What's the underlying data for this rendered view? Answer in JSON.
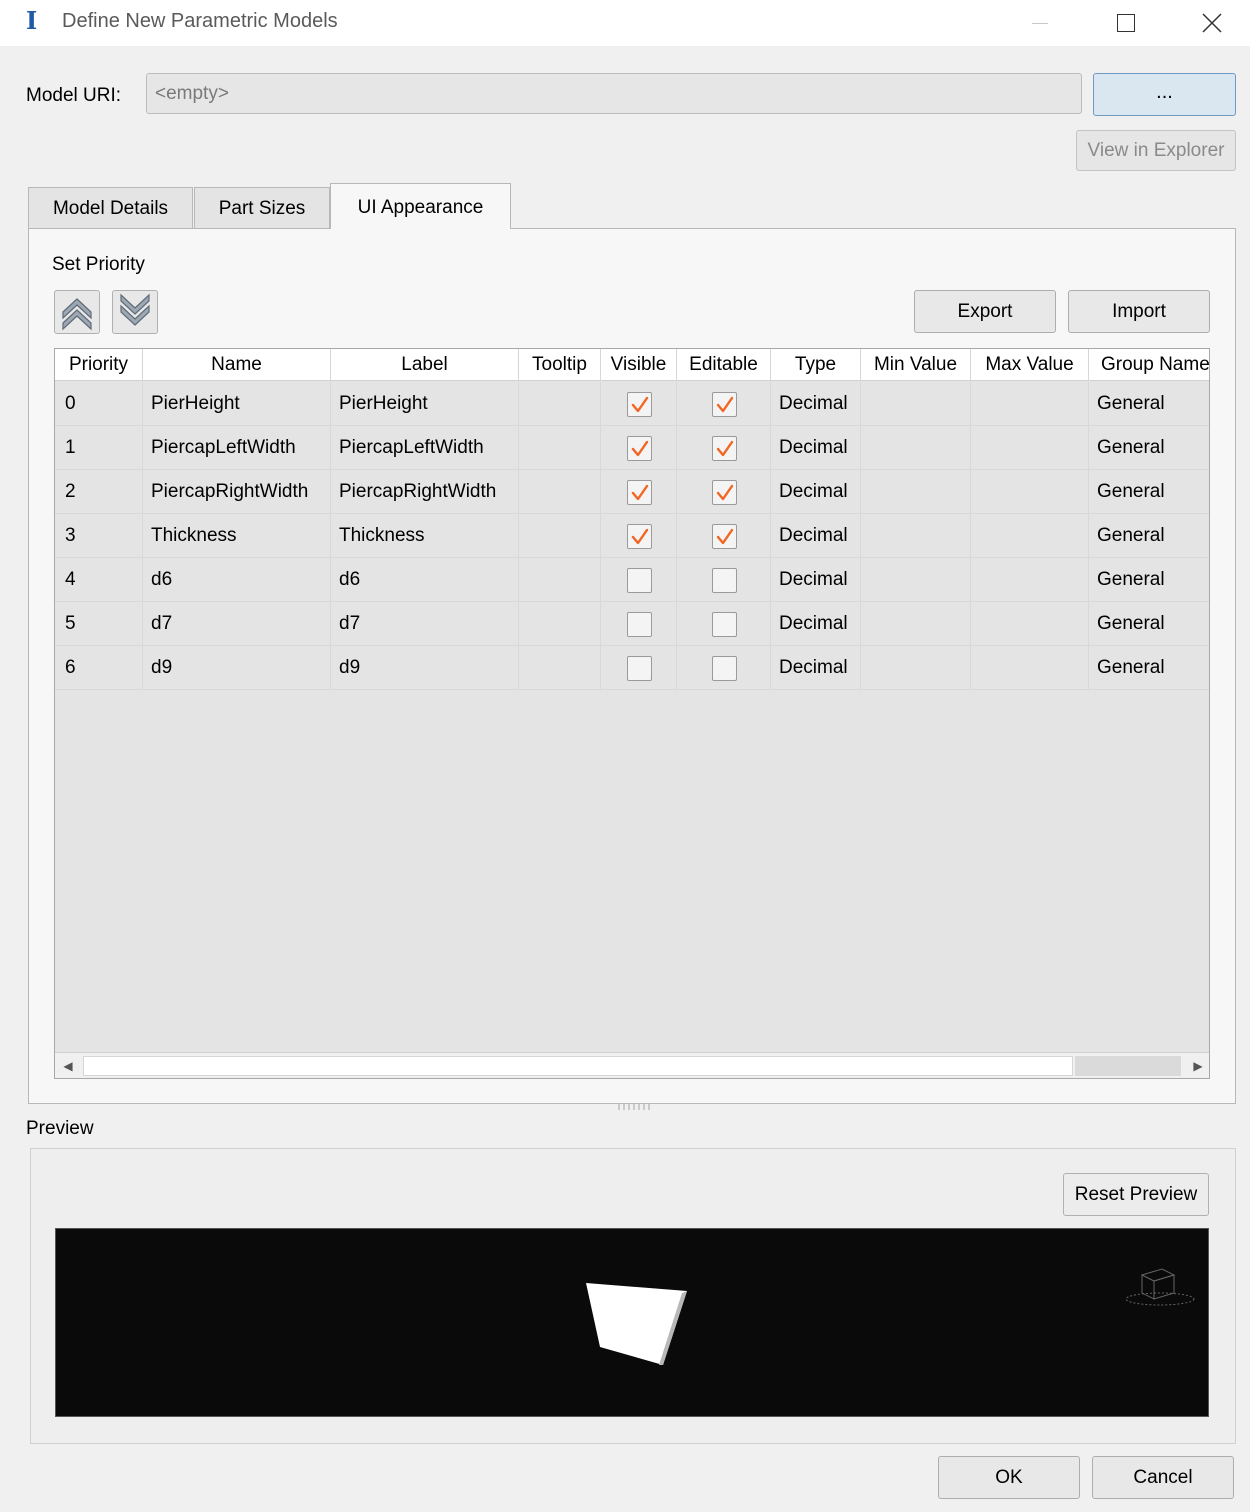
{
  "window": {
    "title": "Define New Parametric Models",
    "app_icon": "I"
  },
  "model_uri": {
    "label": "Model URI:",
    "value": "<empty>",
    "browse_label": "...",
    "explorer_label": "View in Explorer"
  },
  "tabs": [
    {
      "label": "Model Details",
      "active": false
    },
    {
      "label": "Part Sizes",
      "active": false
    },
    {
      "label": "UI Appearance",
      "active": true
    }
  ],
  "set_priority": {
    "label": "Set Priority",
    "up_icon": "double-chevron-up-icon",
    "down_icon": "double-chevron-down-icon"
  },
  "toolbar": {
    "export_label": "Export",
    "import_label": "Import"
  },
  "table": {
    "columns": [
      "Priority",
      "Name",
      "Label",
      "Tooltip",
      "Visible",
      "Editable",
      "Type",
      "Min Value",
      "Max Value",
      "Group Name"
    ],
    "rows": [
      {
        "priority": "0",
        "name": "PierHeight",
        "label": "PierHeight",
        "tooltip": "",
        "visible": true,
        "editable": true,
        "type": "Decimal",
        "min": "",
        "max": "",
        "group": "General"
      },
      {
        "priority": "1",
        "name": "PiercapLeftWidth",
        "label": "PiercapLeftWidth",
        "tooltip": "",
        "visible": true,
        "editable": true,
        "type": "Decimal",
        "min": "",
        "max": "",
        "group": "General"
      },
      {
        "priority": "2",
        "name": "PiercapRightWidth",
        "label": "PiercapRightWidth",
        "tooltip": "",
        "visible": true,
        "editable": true,
        "type": "Decimal",
        "min": "",
        "max": "",
        "group": "General"
      },
      {
        "priority": "3",
        "name": "Thickness",
        "label": "Thickness",
        "tooltip": "",
        "visible": true,
        "editable": true,
        "type": "Decimal",
        "min": "",
        "max": "",
        "group": "General"
      },
      {
        "priority": "4",
        "name": "d6",
        "label": "d6",
        "tooltip": "",
        "visible": false,
        "editable": false,
        "type": "Decimal",
        "min": "",
        "max": "",
        "group": "General"
      },
      {
        "priority": "5",
        "name": "d7",
        "label": "d7",
        "tooltip": "",
        "visible": false,
        "editable": false,
        "type": "Decimal",
        "min": "",
        "max": "",
        "group": "General"
      },
      {
        "priority": "6",
        "name": "d9",
        "label": "d9",
        "tooltip": "",
        "visible": false,
        "editable": false,
        "type": "Decimal",
        "min": "",
        "max": "",
        "group": "General"
      }
    ]
  },
  "preview": {
    "label": "Preview",
    "reset_label": "Reset Preview"
  },
  "footer": {
    "ok_label": "OK",
    "cancel_label": "Cancel"
  },
  "colors": {
    "check_accent": "#f26522",
    "viewport_bg": "#0a0a0a",
    "browse_bg": "#dae6f0"
  }
}
